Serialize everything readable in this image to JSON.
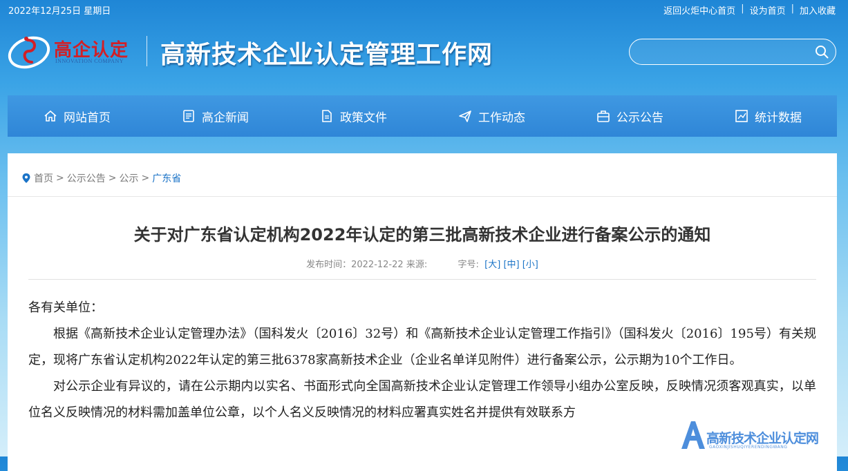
{
  "topbar": {
    "date": "2022年12月25日 星期日",
    "links": [
      "返回火炬中心首页",
      "设为首页",
      "加入收藏"
    ],
    "separator": "|"
  },
  "header": {
    "logo_name": "高企认定",
    "logo_en": "INNOVATION COMPANY",
    "site_title": "高新技术企业认定管理工作网",
    "search_placeholder": "",
    "search_icon": "search-icon"
  },
  "nav": {
    "items": [
      {
        "label": "网站首页",
        "icon": "home-icon"
      },
      {
        "label": "高企新闻",
        "icon": "news-icon"
      },
      {
        "label": "政策文件",
        "icon": "document-icon"
      },
      {
        "label": "工作动态",
        "icon": "send-icon"
      },
      {
        "label": "公示公告",
        "icon": "briefcase-icon"
      },
      {
        "label": "统计数据",
        "icon": "chart-icon"
      }
    ]
  },
  "breadcrumb": {
    "icon": "location-pin-icon",
    "items": [
      "首页",
      "公示公告",
      "公示",
      "广东省"
    ],
    "separator": ">"
  },
  "article": {
    "title": "关于对广东省认定机构2022年认定的第三批高新技术企业进行备案公示的通知",
    "meta": {
      "publish_label": "发布时间：2022-12-22",
      "source_label": "来源:",
      "fontsize_label": "字号:",
      "sizes": [
        "[大]",
        "[中]",
        "[小]"
      ]
    },
    "greeting": "各有关单位：",
    "paragraphs": [
      "根据《高新技术企业认定管理办法》（国科发火〔2016〕32号）和《高新技术企业认定管理工作指引》（国科发火〔2016〕195号）有关规定，现将广东省认定机构2022年认定的第三批6378家高新技术企业（企业名单详见附件）进行备案公示，公示期为10个工作日。",
      "对公示企业有异议的，请在公示期内以实名、书面形式向全国高新技术企业认定管理工作领导小组办公室反映，反映情况须客观真实，以单位名义反映情况的材料需加盖单位公章，以个人名义反映情况的材料应署真实姓名并提供有效联系方"
    ]
  },
  "watermark": {
    "text": "高新技术企业认定网",
    "sub": "GAOXINJISHUQIYERENDINGWANG",
    "colors": {
      "accent": "#2f7bd6"
    }
  },
  "colors": {
    "nav_bg": "#3a8fdc",
    "link_blue": "#1a73c7",
    "logo_red": "#d21f26"
  }
}
